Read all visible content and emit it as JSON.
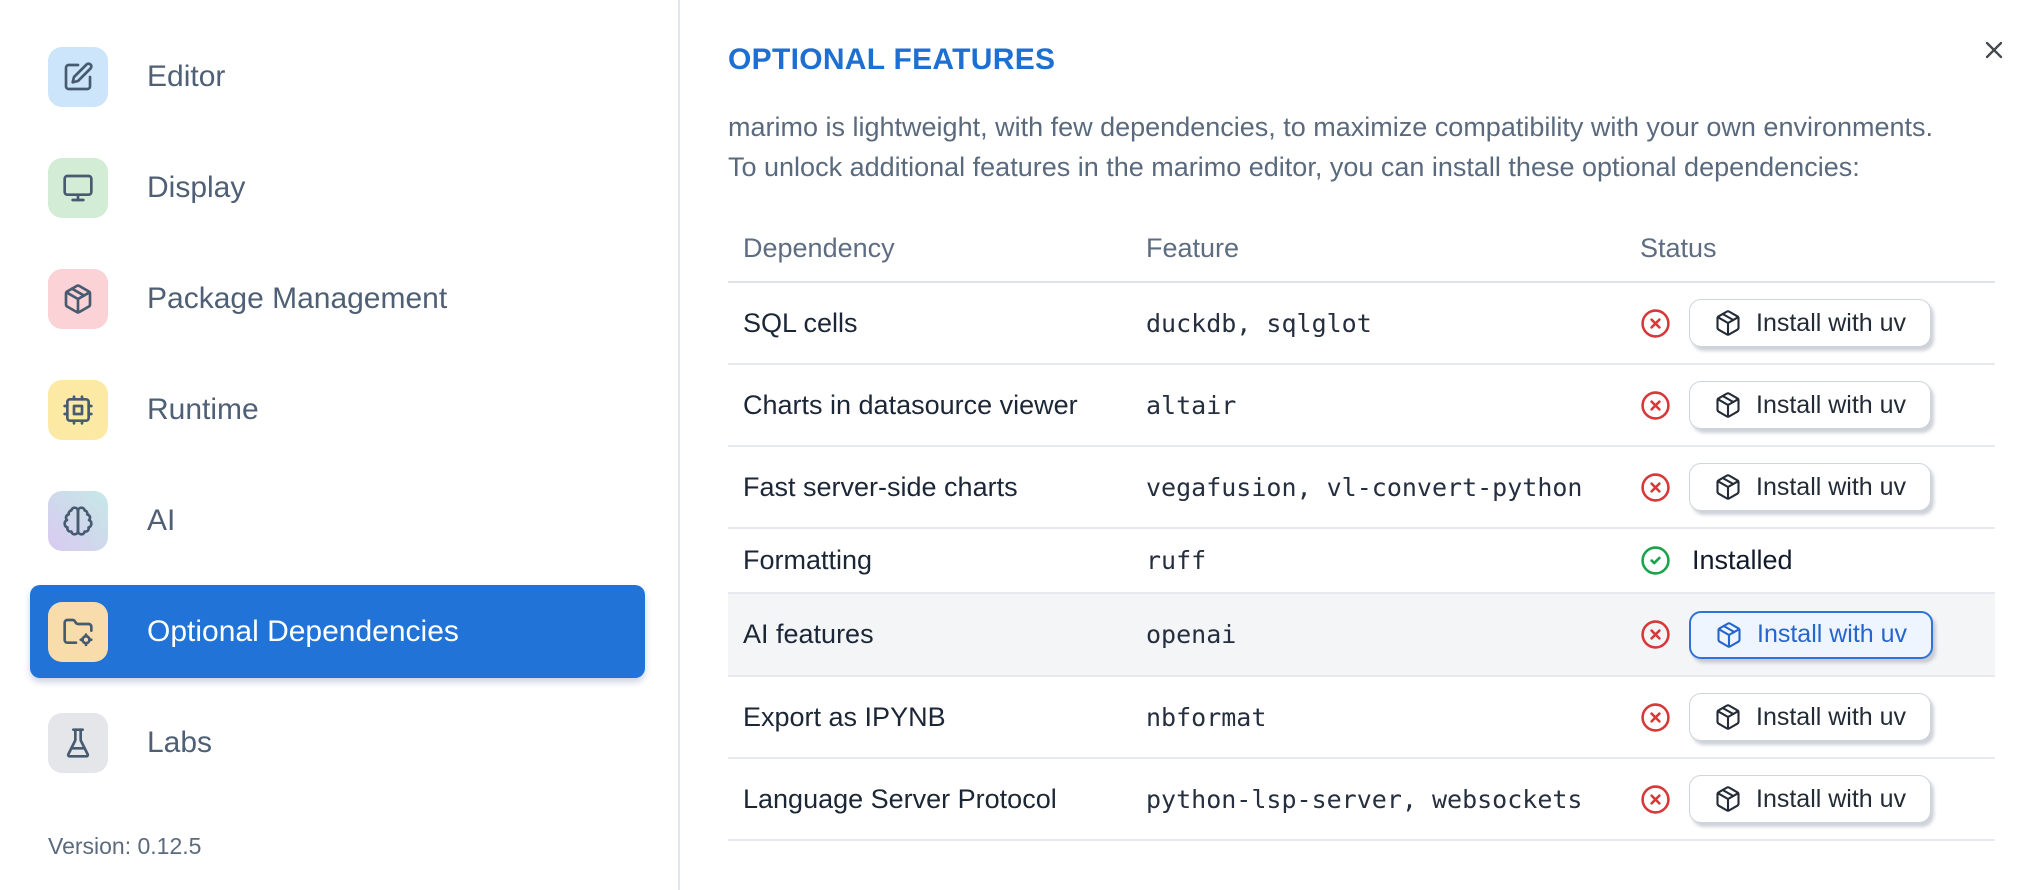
{
  "sidebar": {
    "items": [
      {
        "label": "Editor",
        "icon": "edit-icon",
        "tile_color": "#cde5fa"
      },
      {
        "label": "Display",
        "icon": "monitor-icon",
        "tile_color": "#d2ecd5"
      },
      {
        "label": "Package Management",
        "icon": "package-icon",
        "tile_color": "#fbd2d5"
      },
      {
        "label": "Runtime",
        "icon": "cpu-icon",
        "tile_color": "#fbe9a4"
      },
      {
        "label": "AI",
        "icon": "brain-icon",
        "tile_color": "linear-gradient(to bottom left,#c5e9e6,#d9c9f1)"
      },
      {
        "label": "Optional Dependencies",
        "icon": "folder-cog-icon",
        "tile_color": "#f9dcab",
        "selected": true
      },
      {
        "label": "Labs",
        "icon": "flask-icon",
        "tile_color": "#e5e6e9"
      }
    ],
    "version": "Version: 0.12.5"
  },
  "dialog": {
    "title": "OPTIONAL FEATURES",
    "description": [
      "marimo is lightweight, with few dependencies, to maximize compatibility with your own environments.",
      "To unlock additional features in the marimo editor, you can install these optional dependencies:"
    ]
  },
  "table": {
    "headers": {
      "dependency": "Dependency",
      "feature": "Feature",
      "status": "Status"
    },
    "install_button_label": "Install with uv",
    "installed_label": "Installed",
    "rows": [
      {
        "dependency": "SQL cells",
        "feature": "duckdb, sqlglot",
        "installed": false,
        "focused": false
      },
      {
        "dependency": "Charts in datasource viewer",
        "feature": "altair",
        "installed": false,
        "focused": false
      },
      {
        "dependency": "Fast server-side charts",
        "feature": "vegafusion, vl-convert-python",
        "installed": false,
        "focused": false
      },
      {
        "dependency": "Formatting",
        "feature": "ruff",
        "installed": true,
        "focused": false
      },
      {
        "dependency": "AI features",
        "feature": "openai",
        "installed": false,
        "focused": true
      },
      {
        "dependency": "Export as IPYNB",
        "feature": "nbformat",
        "installed": false,
        "focused": false
      },
      {
        "dependency": "Language Server Protocol",
        "feature": "python-lsp-server, websockets",
        "installed": false,
        "focused": false
      }
    ]
  },
  "colors": {
    "accent_blue": "#2173d8",
    "title_blue": "#1d6fd1",
    "error_red": "#d63939",
    "success_green": "#1aa34a"
  }
}
